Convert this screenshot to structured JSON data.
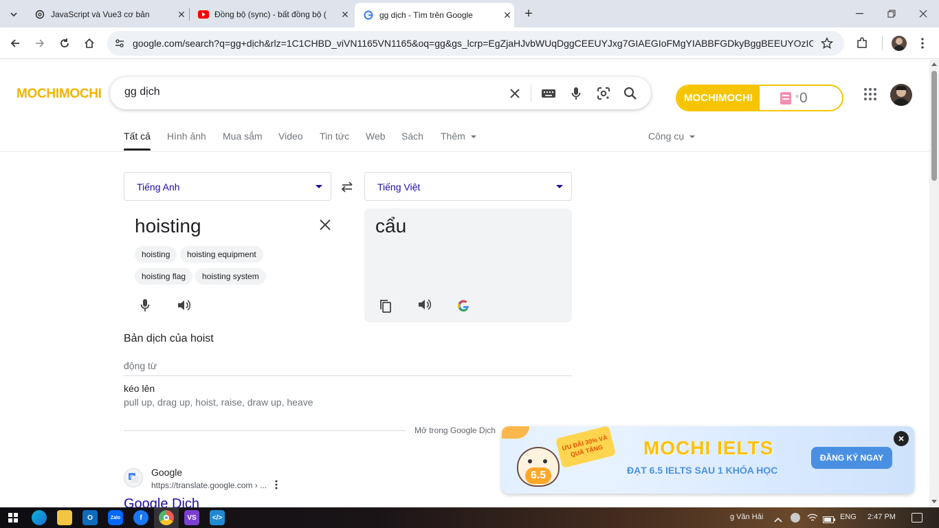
{
  "browser": {
    "tabs": [
      {
        "title": "JavaScript và Vue3 cơ bản",
        "favicon": "openai-icon"
      },
      {
        "title": "Đồng bộ (sync) - bất đồng bộ (",
        "favicon": "youtube-icon"
      },
      {
        "title": "gg dịch - Tìm trên Google",
        "favicon": "google-icon",
        "active": true
      }
    ],
    "url": "google.com/search?q=gg+dịch&rlz=1C1CHBD_viVN1165VN1165&oq=gg&gs_lcrp=EgZjaHJvbWUqDggCEEUYJxg7GIAEGIoFMgYIABBFGDkyBggBEEUYOzIOCA..."
  },
  "search": {
    "logo": "MOCHIMOCHI",
    "query": "gg dịch",
    "mochi_widget": {
      "label": "MOCHIMOCHI",
      "count": "0"
    },
    "tabs": [
      "Tất cả",
      "Hình ảnh",
      "Mua sắm",
      "Video",
      "Tin tức",
      "Web",
      "Sách",
      "Thêm"
    ],
    "tools_label": "Công cụ"
  },
  "translate": {
    "source_lang": "Tiếng Anh",
    "target_lang": "Tiếng Việt",
    "source_text": "hoisting",
    "target_text": "cẩu",
    "suggestions": [
      "hoisting",
      "hoisting equipment",
      "hoisting flag",
      "hoisting system"
    ],
    "dictionary_title": "Bản dịch của hoist",
    "part_of_speech": "động từ",
    "entry_word": "kéo lên",
    "entry_synonyms": "pull up, drag up, hoist, raise, draw up, heave",
    "open_link": "Mở trong Google Dịch"
  },
  "result": {
    "site_name": "Google",
    "site_url": "https://translate.google.com › ...",
    "title": "Google Dịch"
  },
  "promo": {
    "badge": "ƯU ĐÃI 30% VÀ QUÀ TẶNG",
    "score": "6.5",
    "brand": "MOCHI IELTS",
    "tagline": "ĐẠT 6.5 IELTS SAU 1 KHÓA HỌC",
    "cta": "ĐĂNG KÝ NGAY"
  },
  "taskbar": {
    "user": "g Văn Hải",
    "lang": "ENG",
    "time": "2:47 PM"
  },
  "colors": {
    "accent_yellow": "#f6c500",
    "link_blue": "#1a0dab",
    "promo_blue": "#4a90e2"
  }
}
